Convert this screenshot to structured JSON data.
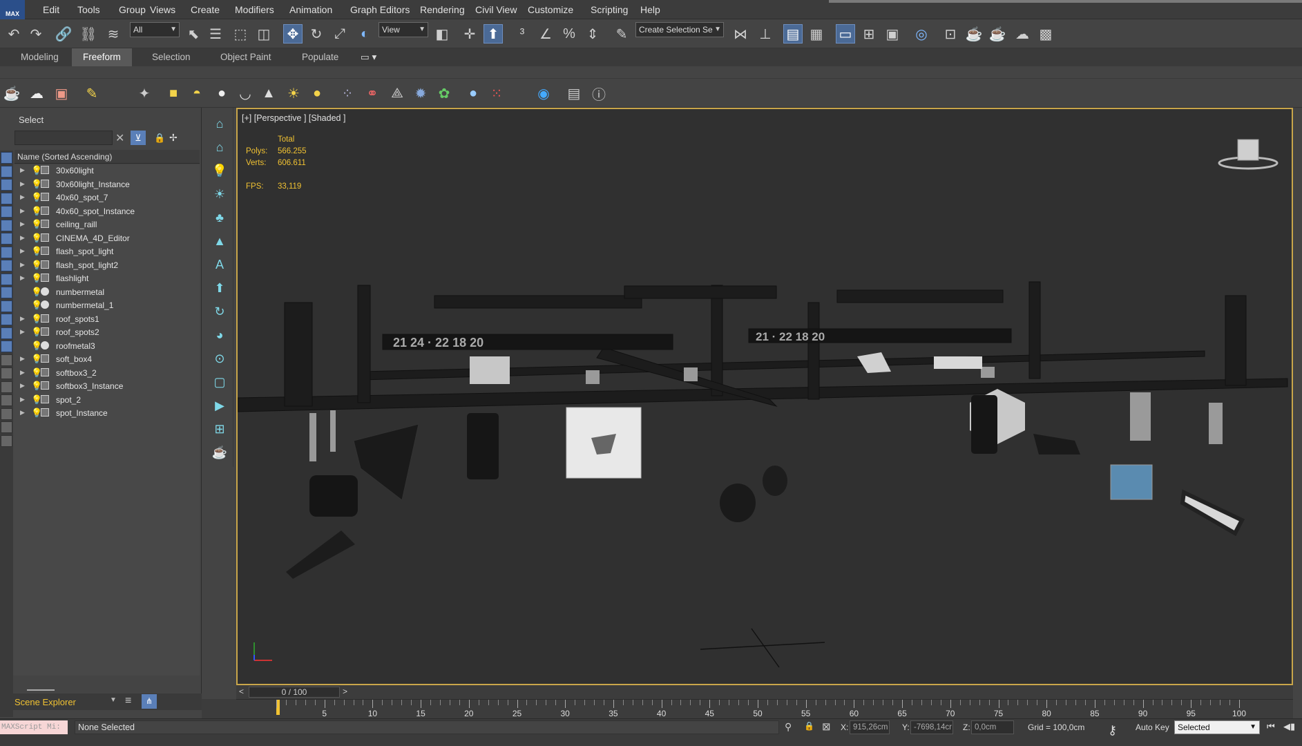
{
  "app": {
    "logo": "MAX"
  },
  "menu": [
    "Edit",
    "Tools",
    "Group",
    "Views",
    "Create",
    "Modifiers",
    "Animation",
    "Graph Editors",
    "Rendering",
    "Civil View",
    "Customize",
    "Scripting",
    "Help"
  ],
  "toolbar": {
    "selection_filter": "All",
    "ref_coord": "View",
    "named_selection_placeholder": "Create Selection Se"
  },
  "ribbon": {
    "tabs": [
      "Modeling",
      "Freeform",
      "Selection",
      "Object Paint",
      "Populate"
    ],
    "active": "Freeform"
  },
  "explorer": {
    "title": "Select",
    "column_header": "Name (Sorted Ascending)",
    "footer_label": "Scene Explorer",
    "items": [
      {
        "name": "30x60light",
        "type": "light"
      },
      {
        "name": "30x60light_Instance",
        "type": "light"
      },
      {
        "name": "40x60_spot_7",
        "type": "light"
      },
      {
        "name": "40x60_spot_Instance",
        "type": "light"
      },
      {
        "name": "ceiling_raill",
        "type": "light"
      },
      {
        "name": "CINEMA_4D_Editor",
        "type": "camera"
      },
      {
        "name": "flash_spot_light",
        "type": "light"
      },
      {
        "name": "flash_spot_light2",
        "type": "light"
      },
      {
        "name": "flashlight",
        "type": "light"
      },
      {
        "name": "numbermetal",
        "type": "sphere"
      },
      {
        "name": "numbermetal_1",
        "type": "sphere"
      },
      {
        "name": "roof_spots1",
        "type": "light"
      },
      {
        "name": "roof_spots2",
        "type": "light"
      },
      {
        "name": "roofmetal3",
        "type": "sphere"
      },
      {
        "name": "soft_box4",
        "type": "light"
      },
      {
        "name": "softbox3_2",
        "type": "light"
      },
      {
        "name": "softbox3_Instance",
        "type": "light"
      },
      {
        "name": "spot_2",
        "type": "light"
      },
      {
        "name": "spot_Instance",
        "type": "light"
      }
    ]
  },
  "viewport": {
    "label": "[+] [Perspective ] [Shaded ]",
    "stats_header": "Total",
    "polys_label": "Polys:",
    "polys": "566.255",
    "verts_label": "Verts:",
    "verts": "606.611",
    "fps_label": "FPS:",
    "fps": "33,119",
    "numbers_left": "21  24  ·  22 18 20",
    "numbers_right": "21  ·  22 18 20"
  },
  "timeline": {
    "slider_label": "0 / 100",
    "ticks": [
      5,
      10,
      15,
      20,
      25,
      30,
      35,
      40,
      45,
      50,
      55,
      60,
      65,
      70,
      75,
      80,
      85,
      90,
      95,
      100
    ]
  },
  "status": {
    "maxscript": "MAXScript Mi:",
    "message": "None Selected",
    "x_label": "X:",
    "x_value": "915,26cm",
    "y_label": "Y:",
    "y_value": "-7698,14cr",
    "z_label": "Z:",
    "z_value": "0,0cm",
    "grid": "Grid = 100,0cm",
    "auto_key": "Auto Key",
    "selected": "Selected"
  },
  "colors": {
    "viewport_border": "#c9a64a",
    "stats": "#f1c232",
    "active_button": "#4b6a96"
  }
}
